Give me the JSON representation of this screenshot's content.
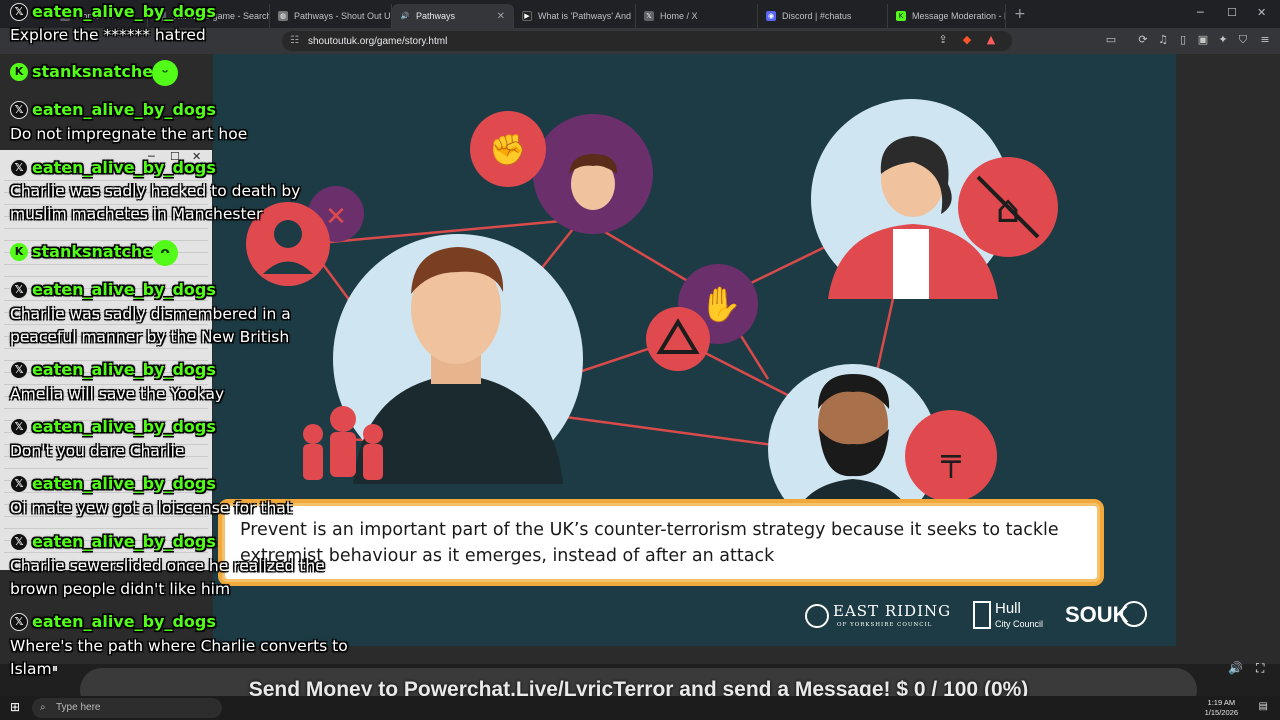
{
  "browser": {
    "tabs": [
      {
        "label": "Home / X",
        "icon": "x-icon",
        "active": false
      },
      {
        "label": "pathways game - Search",
        "icon": "x-icon",
        "active": false
      },
      {
        "label": "Pathways - Shout Out UK",
        "icon": "globe-icon",
        "active": false
      },
      {
        "label": "Pathways",
        "icon": "speaker-icon",
        "active": true
      },
      {
        "label": "What is 'Pathways' And",
        "icon": "video-icon",
        "active": false
      },
      {
        "label": "Home / X",
        "icon": "x-icon",
        "active": false
      },
      {
        "label": "Discord | #chatus",
        "icon": "discord-icon",
        "active": false
      },
      {
        "label": "Message Moderation - K",
        "icon": "kick-icon",
        "active": false
      }
    ],
    "url": "shoutoutuk.org/game/story.html"
  },
  "video": {
    "caption": "Prevent is an important part of the UK’s counter-terrorism strategy because it seeks to tackle extremist behaviour as it emerges, instead of after an attack",
    "logos": {
      "east_riding": "EAST RIDING",
      "east_riding_sub": "OF YORKSHIRE COUNCIL",
      "hull": "Hull",
      "hull_sub": "City Council",
      "souk": "SOUK"
    }
  },
  "chat": [
    {
      "user": "eaten_alive_by_dogs",
      "platform": "x",
      "text": "Explore the ****** hatred"
    },
    {
      "user": "stanksnatcher",
      "platform": "kick",
      "text": ""
    },
    {
      "user": "eaten_alive_by_dogs",
      "platform": "x",
      "text": "Do not impregnate the art hoe"
    },
    {
      "user": "eaten_alive_by_dogs",
      "platform": "x",
      "text": "Charlie was sadly hacked to death by\nmuslim machetes in Manchester"
    },
    {
      "user": "stanksnatcher",
      "platform": "kick",
      "text": ""
    },
    {
      "user": "eaten_alive_by_dogs",
      "platform": "x",
      "text": "Charlie was sadly dismembered in a\npeaceful manner by the New British"
    },
    {
      "user": "eaten_alive_by_dogs",
      "platform": "x",
      "text": "Amelia will save the Yookay"
    },
    {
      "user": "eaten_alive_by_dogs",
      "platform": "x",
      "text": "Don't you dare Charlie"
    },
    {
      "user": "eaten_alive_by_dogs",
      "platform": "x",
      "text": "Oi mate yew got a loiscense for that"
    },
    {
      "user": "eaten_alive_by_dogs",
      "platform": "x",
      "text": "Charlie sewerslided once he realized the\nbrown people didn't like him"
    },
    {
      "user": "eaten_alive_by_dogs",
      "platform": "x",
      "text": "Where's the path where Charlie converts to\nIslam"
    }
  ],
  "donation_bar": "Send Money to Powerchat.Live/LyricTerror and send a Message! $ 0 / 100 (0%)",
  "taskbar": {
    "search_placeholder": "Type here",
    "time": "1:19 AM",
    "date": "1/15/2026"
  },
  "colors": {
    "kick_green": "#53fc18",
    "caption_border": "#f2a93b",
    "stage_bg": "#1d3b44",
    "network_red": "#d94a4a"
  }
}
